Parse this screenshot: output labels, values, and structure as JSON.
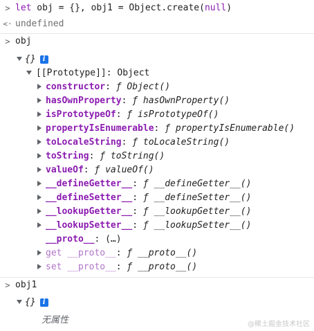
{
  "input1": {
    "prompt_icon": "chevron-right-icon",
    "tokens": {
      "let": "let",
      "rest": " obj = {}, obj1 = Object.create(",
      "null": "null",
      "close": ")"
    }
  },
  "output1": {
    "return_icon": "return-arrow-icon",
    "value": "undefined"
  },
  "input2": {
    "prompt_icon": "chevron-right-icon",
    "text": "obj"
  },
  "obj_result": {
    "summary": "{}",
    "info_label": "i",
    "prototype_label": "[[Prototype]]: Object",
    "members": [
      {
        "name": "constructor",
        "sep": ": ",
        "f": "ƒ",
        "sig": " Object()",
        "expandable": true,
        "dim": false
      },
      {
        "name": "hasOwnProperty",
        "sep": ": ",
        "f": "ƒ",
        "sig": " hasOwnProperty()",
        "expandable": true,
        "dim": false
      },
      {
        "name": "isPrototypeOf",
        "sep": ": ",
        "f": "ƒ",
        "sig": " isPrototypeOf()",
        "expandable": true,
        "dim": false
      },
      {
        "name": "propertyIsEnumerable",
        "sep": ": ",
        "f": "ƒ",
        "sig": " propertyIsEnumerable()",
        "expandable": true,
        "dim": false
      },
      {
        "name": "toLocaleString",
        "sep": ": ",
        "f": "ƒ",
        "sig": " toLocaleString()",
        "expandable": true,
        "dim": false
      },
      {
        "name": "toString",
        "sep": ": ",
        "f": "ƒ",
        "sig": " toString()",
        "expandable": true,
        "dim": false
      },
      {
        "name": "valueOf",
        "sep": ": ",
        "f": "ƒ",
        "sig": " valueOf()",
        "expandable": true,
        "dim": false
      },
      {
        "name": "__defineGetter__",
        "sep": ": ",
        "f": "ƒ",
        "sig": " __defineGetter__()",
        "expandable": true,
        "dim": false
      },
      {
        "name": "__defineSetter__",
        "sep": ": ",
        "f": "ƒ",
        "sig": " __defineSetter__()",
        "expandable": true,
        "dim": false
      },
      {
        "name": "__lookupGetter__",
        "sep": ": ",
        "f": "ƒ",
        "sig": " __lookupGetter__()",
        "expandable": true,
        "dim": false
      },
      {
        "name": "__lookupSetter__",
        "sep": ": ",
        "f": "ƒ",
        "sig": " __lookupSetter__()",
        "expandable": true,
        "dim": false
      },
      {
        "name": "__proto__",
        "sep": ": ",
        "f": "",
        "sig": "(…)",
        "expandable": false,
        "dim": false
      },
      {
        "name": "get __proto__",
        "sep": ": ",
        "f": "ƒ",
        "sig": " __proto__()",
        "expandable": true,
        "dim": true
      },
      {
        "name": "set __proto__",
        "sep": ": ",
        "f": "ƒ",
        "sig": " __proto__()",
        "expandable": true,
        "dim": true
      }
    ]
  },
  "input3": {
    "prompt_icon": "chevron-right-icon",
    "text": "obj1"
  },
  "obj1_result": {
    "summary": "{}",
    "info_label": "i",
    "empty_label": "无属性"
  },
  "watermark": "@稀土掘金技术社区",
  "colors": {
    "keyword": "#8b1bb0",
    "info_badge": "#1a73e8",
    "muted": "#6e6e6e"
  }
}
